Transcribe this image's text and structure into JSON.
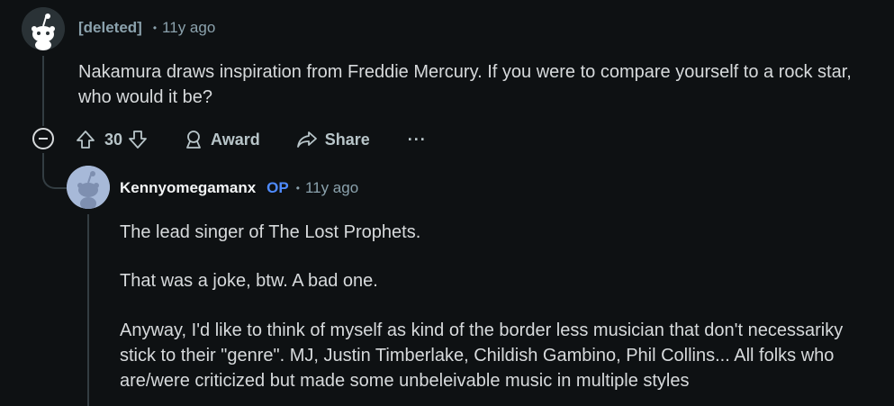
{
  "parent_comment": {
    "username": "[deleted]",
    "separator": "•",
    "time": "11y ago",
    "text": "Nakamura draws inspiration from Freddie Mercury. If you were to compare yourself to a rock star, who would it be?",
    "score": "30",
    "award_label": "Award",
    "share_label": "Share",
    "more_label": "···"
  },
  "reply": {
    "username": "Kennyomegamanx",
    "op_tag": "OP",
    "separator": "•",
    "time": "11y ago",
    "paragraphs": [
      "The lead singer of The Lost Prophets.",
      "That was a joke, btw. A bad one.",
      "Anyway, I'd like to think of myself as kind of the border less musician that don't necessariky stick to their \"genre\". MJ, Justin Timberlake, Childish Gambino, Phil Collins... All folks who are/were criticized but made some unbeleivable music in multiple styles"
    ]
  },
  "colors": {
    "background": "#0e1113",
    "text": "#d7dadc",
    "meta": "#8ba2ad",
    "op_tag": "#4f8bff",
    "thread_line": "#333d42"
  },
  "icons": {
    "collapse": "collapse-minus-icon",
    "upvote": "upvote-arrow-icon",
    "downvote": "downvote-arrow-icon",
    "award": "award-icon",
    "share": "share-icon",
    "more": "more-dots-icon"
  }
}
